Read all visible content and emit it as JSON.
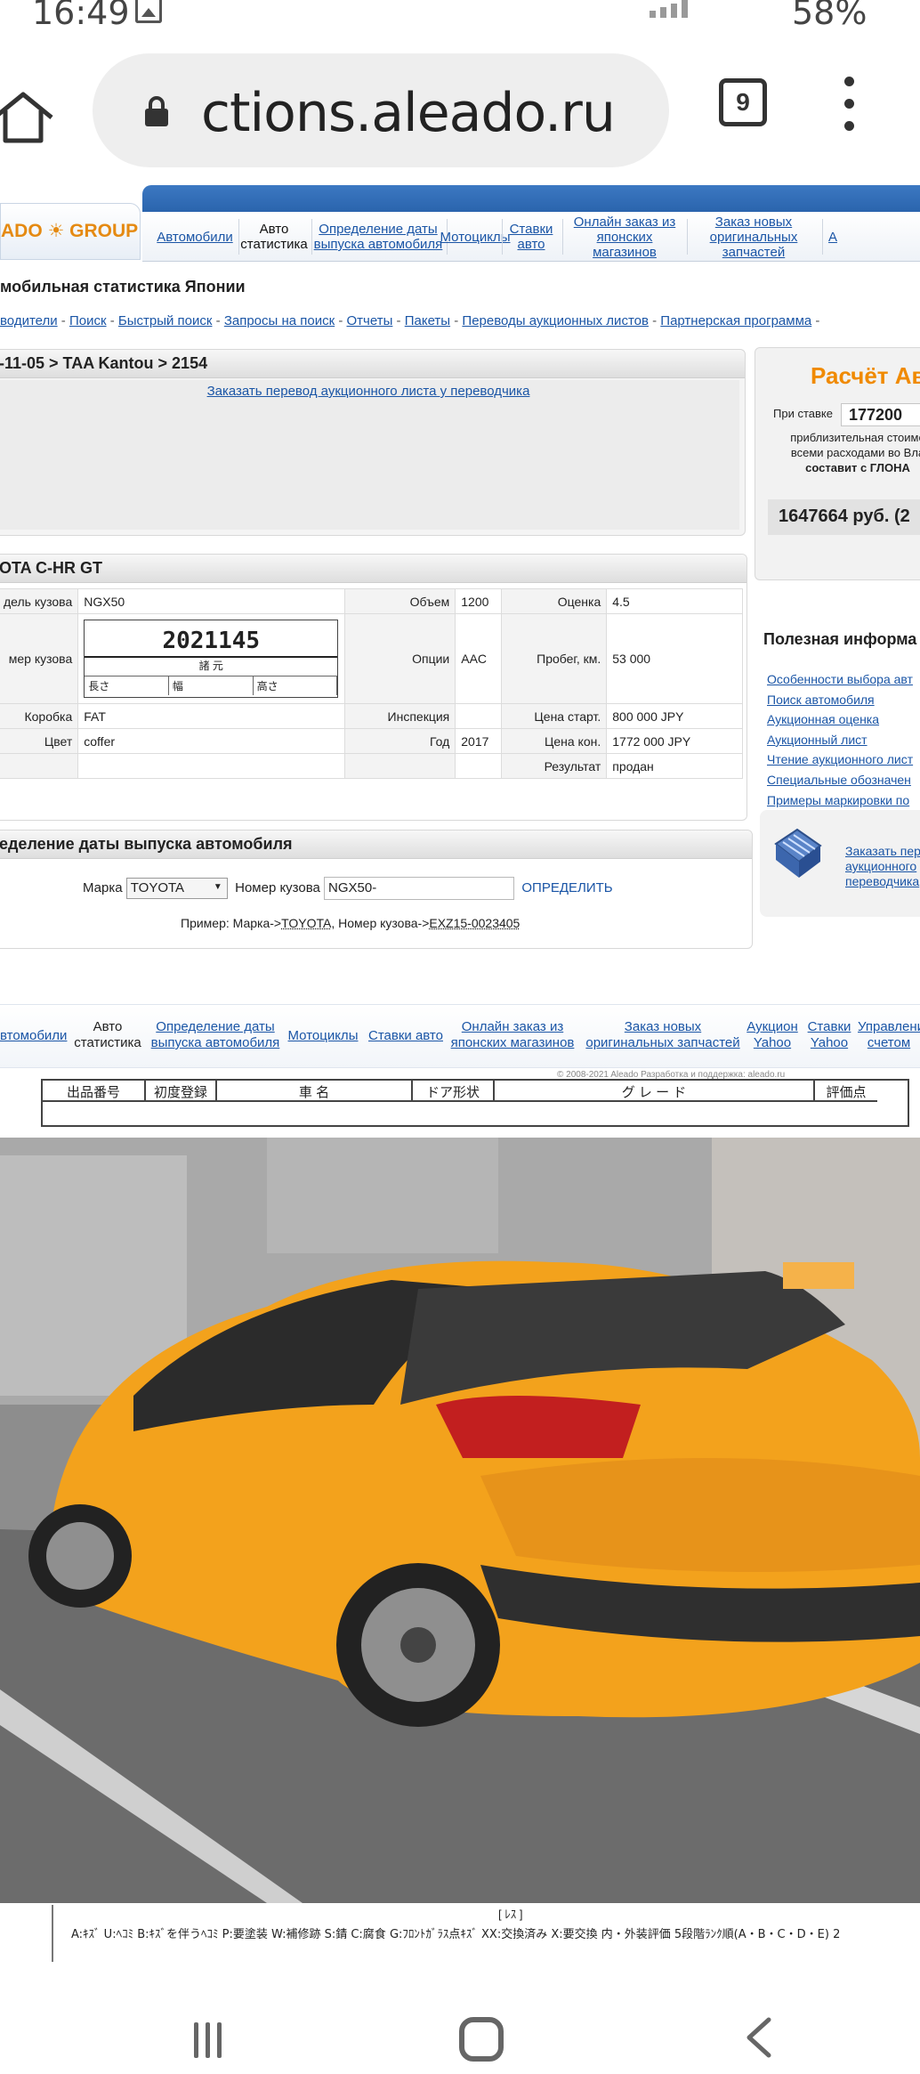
{
  "status_bar": {
    "time": "16:49",
    "battery": "58%"
  },
  "browser": {
    "url": "ctions.aleado.ru",
    "tab_count": "9"
  },
  "site": {
    "logo": "ADO ☀ GROUP",
    "top_nav": [
      "Автомобили",
      "Авто статистика",
      "Определение даты выпуска автомобиля",
      "Мотоциклы",
      "Ставки авто",
      "Онлайн заказ из японских магазинов",
      "Заказ новых оригинальных запчастей",
      "А"
    ],
    "section_title": "мобильная статистика Японии",
    "sub_links": [
      "водители",
      "Поиск",
      "Быстрый поиск",
      "Запросы на поиск",
      "Отчеты",
      "Пакеты",
      "Переводы аукционных листов",
      "Партнерская программа"
    ]
  },
  "lot": {
    "header": "-11-05 > TAA Kantou > 2154",
    "order_link": "Заказать перевод аукционного листа у переводчика"
  },
  "car": {
    "header": "OTA C-HR GT",
    "rows": [
      {
        "l1": "дель кузова",
        "v1": "NGX50",
        "l2": "Объем",
        "v2": "1200",
        "l3": "Оценка",
        "v3": "4.5"
      },
      {
        "l1": "мер кузова",
        "v1": "",
        "l2": "Опции",
        "v2": "AAC",
        "l3": "Пробег, км.",
        "v3": "53 000"
      },
      {
        "l1": "Коробка",
        "v1": "FAT",
        "l2": "Инспекция",
        "v2": "",
        "l3": "Цена старт.",
        "v3": "800 000 JPY"
      },
      {
        "l1": "Цвет",
        "v1": "coffer",
        "l2": "Год",
        "v2": "2017",
        "l3": "Цена кон.",
        "v3": "1772 000 JPY"
      },
      {
        "l1": "",
        "v1": "",
        "l2": "",
        "v2": "",
        "l3": "Результат",
        "v3": "продан"
      }
    ],
    "body_number_image": {
      "number": "2021145",
      "jp_label": "諸 元",
      "dims": [
        "長さ",
        "幅",
        "高さ"
      ]
    }
  },
  "date_form": {
    "header": "еделение даты выпуска автомобиля",
    "make_label": "Марка",
    "make_value": "TOYOTA",
    "body_label": "Номер кузова",
    "body_value": "NGX50-",
    "submit": "ОПРЕДЕЛИТЬ",
    "example_prefix": "Пример: Марка->",
    "example_make": "TOYOTA",
    "example_mid": ", Номер кузова->",
    "example_body": "EXZ15-0023405"
  },
  "calc": {
    "title": "Расчёт Ав",
    "stake_label": "При ставке",
    "stake_value": "177200",
    "desc_1": "приблизительная стоимо",
    "desc_2": "всеми расходами во Вла",
    "desc_3": "составит с ГЛОНА",
    "total": "1647664 руб. (2"
  },
  "info": {
    "title": "Полезная информа",
    "links": [
      "Особенности выбора авт",
      "Поиск автомобиля",
      "Аукционная оценка",
      "Аукционный лист",
      "Чтение аукционного лист",
      "Специальные обозначен",
      "Примеры маркировки по"
    ]
  },
  "order_translation": {
    "line1": "Заказать пер",
    "line2": "аукционного",
    "line3": "переводчика"
  },
  "footer_nav": [
    "втомобили",
    "Авто статистика",
    "Определение даты выпуска автомобиля",
    "Мотоциклы",
    "Ставки авто",
    "Онлайн заказ из японских магазинов",
    "Заказ новых оригинальных запчастей",
    "Аукцион Yahoo",
    "Ставки Yahoo",
    "Управлени счетом"
  ],
  "copyright": "© 2008-2021 Aleado Разработка и поддержка: aleado.ru",
  "sheet": {
    "cells": [
      "出品番号",
      "初度登録",
      "車 名",
      "ドア形状",
      "グ レ ー ド",
      "評価点"
    ],
    "legend": "A:ｷｽﾞ U:ﾍｺﾐ B:ｷｽﾞを伴うﾍｺﾐ P:要塗装 W:補修跡 S:錆 C:腐食 G:ﾌﾛﾝﾄｶﾞﾗｽ点ｷｽﾞ XX:交換済み X:要交換 内・外装評価 5段階ﾗﾝｸ順(A・B・C・D・E) 2",
    "bracket": "[ ﾚｽ ]"
  },
  "colors": {
    "accent_orange": "#f08a00",
    "link_blue": "#1a55a6",
    "nav_blue": "#2a64ad",
    "car_yellow": "#f3a21c"
  }
}
